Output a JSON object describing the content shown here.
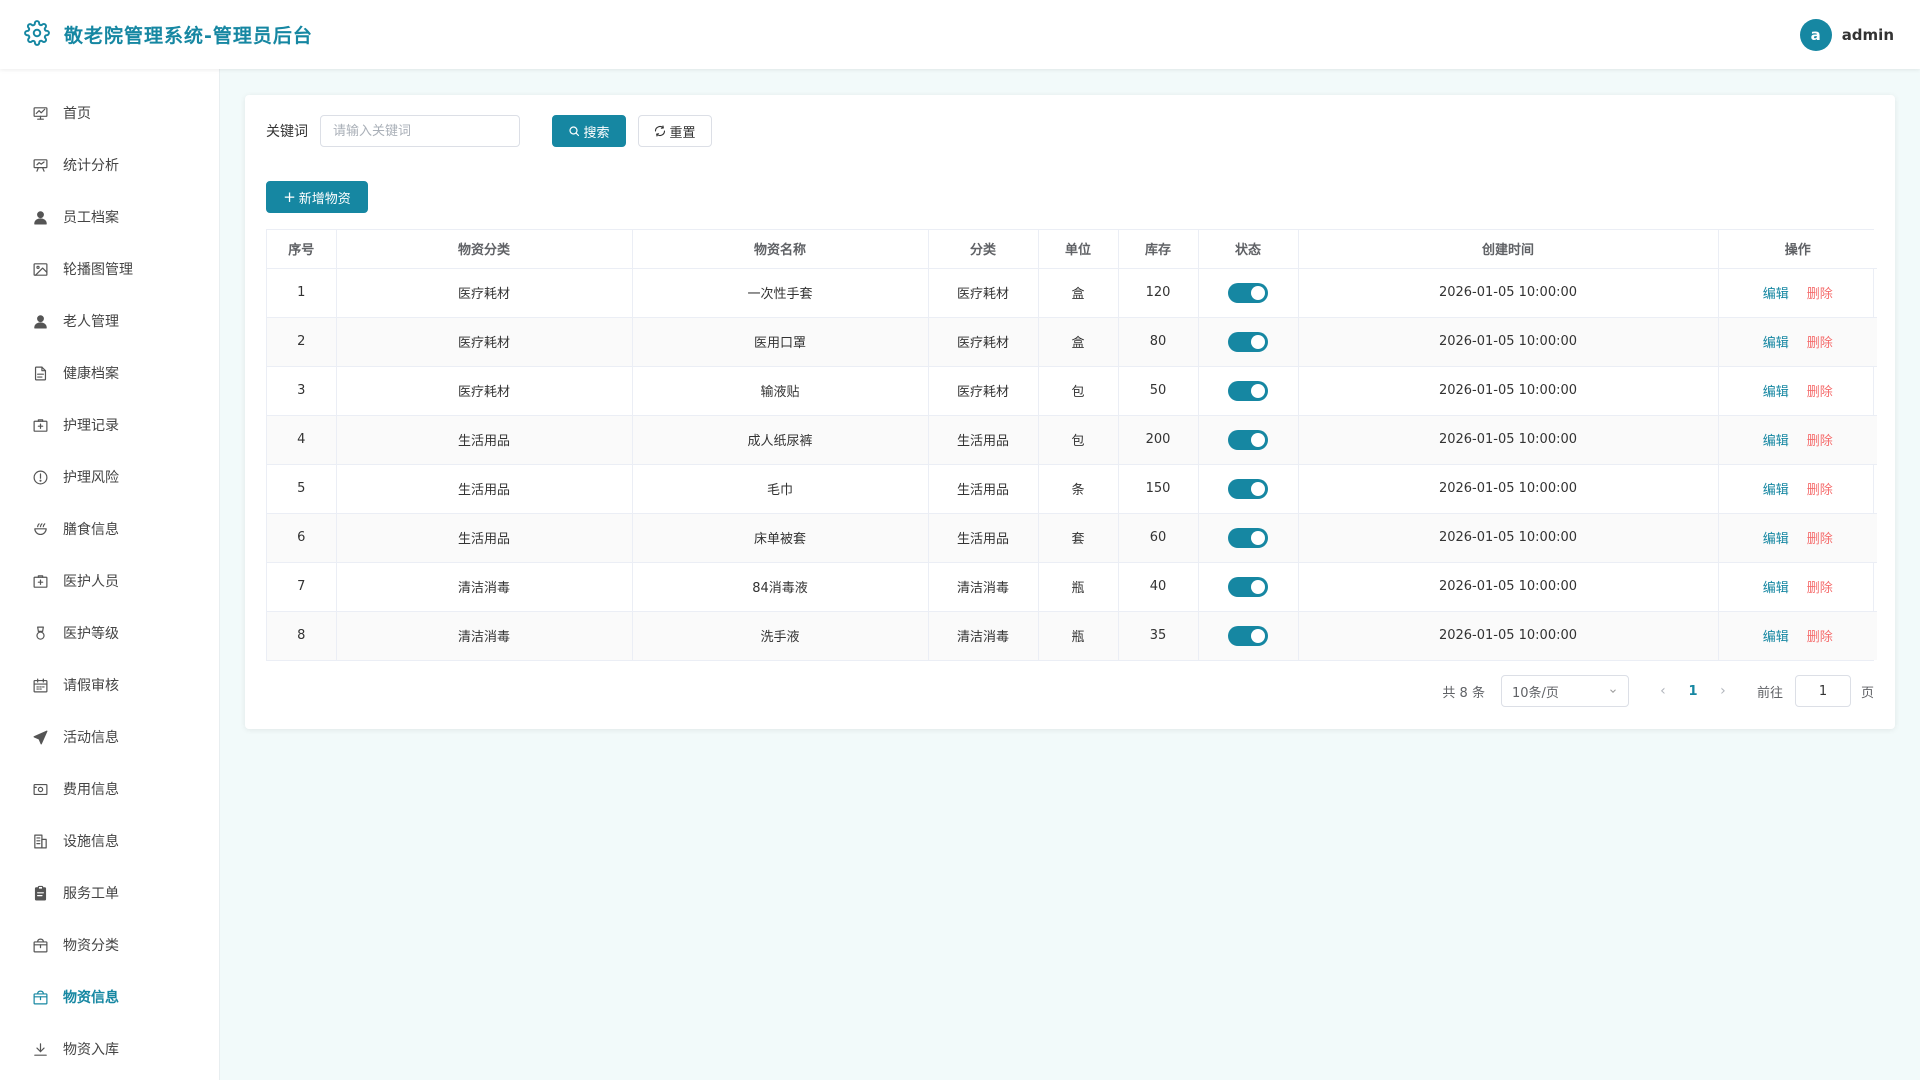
{
  "header": {
    "title": "敬老院管理系统-管理员后台",
    "avatar_letter": "a",
    "username": "admin"
  },
  "sidebar": {
    "items": [
      {
        "label": "首页",
        "icon": "dashboard-icon"
      },
      {
        "label": "统计分析",
        "icon": "presentation-chart-icon"
      },
      {
        "label": "员工档案",
        "icon": "user-icon"
      },
      {
        "label": "轮播图管理",
        "icon": "image-icon"
      },
      {
        "label": "老人管理",
        "icon": "user-icon"
      },
      {
        "label": "健康档案",
        "icon": "document-icon"
      },
      {
        "label": "护理记录",
        "icon": "medical-box-icon"
      },
      {
        "label": "护理风险",
        "icon": "warning-circle-icon"
      },
      {
        "label": "膳食信息",
        "icon": "bowl-icon"
      },
      {
        "label": "医护人员",
        "icon": "medical-box-icon"
      },
      {
        "label": "医护等级",
        "icon": "medal-icon"
      },
      {
        "label": "请假审核",
        "icon": "calendar-icon"
      },
      {
        "label": "活动信息",
        "icon": "paper-plane-icon"
      },
      {
        "label": "费用信息",
        "icon": "wallet-icon"
      },
      {
        "label": "设施信息",
        "icon": "building-icon"
      },
      {
        "label": "服务工单",
        "icon": "clipboard-icon"
      },
      {
        "label": "物资分类",
        "icon": "box-icon"
      },
      {
        "label": "物资信息",
        "icon": "box-icon",
        "active": true
      },
      {
        "label": "物资入库",
        "icon": "download-icon"
      }
    ]
  },
  "search": {
    "label": "关键词",
    "placeholder": "请输入关键词",
    "value": "",
    "search_button": "搜索",
    "reset_button": "重置"
  },
  "toolbar": {
    "add_button": "新增物资"
  },
  "table": {
    "columns": [
      "序号",
      "物资分类",
      "物资名称",
      "分类",
      "单位",
      "库存",
      "状态",
      "创建时间",
      "操作"
    ],
    "edit_label": "编辑",
    "delete_label": "删除",
    "rows": [
      {
        "no": "1",
        "category": "医疗耗材",
        "name": "一次性手套",
        "type": "医疗耗材",
        "unit": "盒",
        "stock": "120",
        "enabled": true,
        "created": "2026-01-05 10:00:00"
      },
      {
        "no": "2",
        "category": "医疗耗材",
        "name": "医用口罩",
        "type": "医疗耗材",
        "unit": "盒",
        "stock": "80",
        "enabled": true,
        "created": "2026-01-05 10:00:00"
      },
      {
        "no": "3",
        "category": "医疗耗材",
        "name": "输液贴",
        "type": "医疗耗材",
        "unit": "包",
        "stock": "50",
        "enabled": true,
        "created": "2026-01-05 10:00:00"
      },
      {
        "no": "4",
        "category": "生活用品",
        "name": "成人纸尿裤",
        "type": "生活用品",
        "unit": "包",
        "stock": "200",
        "enabled": true,
        "created": "2026-01-05 10:00:00"
      },
      {
        "no": "5",
        "category": "生活用品",
        "name": "毛巾",
        "type": "生活用品",
        "unit": "条",
        "stock": "150",
        "enabled": true,
        "created": "2026-01-05 10:00:00"
      },
      {
        "no": "6",
        "category": "生活用品",
        "name": "床单被套",
        "type": "生活用品",
        "unit": "套",
        "stock": "60",
        "enabled": true,
        "created": "2026-01-05 10:00:00"
      },
      {
        "no": "7",
        "category": "清洁消毒",
        "name": "84消毒液",
        "type": "清洁消毒",
        "unit": "瓶",
        "stock": "40",
        "enabled": true,
        "created": "2026-01-05 10:00:00"
      },
      {
        "no": "8",
        "category": "清洁消毒",
        "name": "洗手液",
        "type": "清洁消毒",
        "unit": "瓶",
        "stock": "35",
        "enabled": true,
        "created": "2026-01-05 10:00:00"
      }
    ]
  },
  "pagination": {
    "total_text": "共 8 条",
    "page_size": "10条/页",
    "current_page": "1",
    "goto_label": "前往",
    "goto_value": "1",
    "page_suffix": "页"
  },
  "colors": {
    "accent": "#1687a2",
    "danger": "#f56c6c",
    "background": "#f2fafa"
  }
}
